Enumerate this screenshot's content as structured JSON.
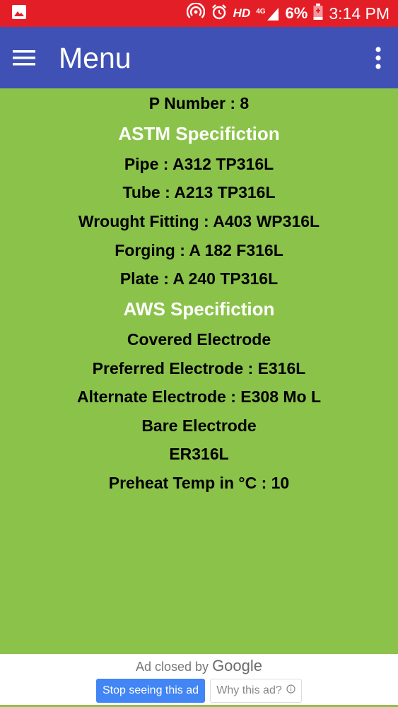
{
  "status_bar": {
    "network": "HD",
    "signal": "4G",
    "battery": "6%",
    "time": "3:14 PM",
    "icons": [
      "image-icon",
      "hotspot-icon",
      "alarm-icon",
      "signal-icon",
      "battery-charging-icon"
    ]
  },
  "app_bar": {
    "title": "Menu",
    "menu_icon": "hamburger-menu-icon",
    "overflow_icon": "more-vert-icon"
  },
  "content": {
    "p_number": "P Number : 8",
    "astm_heading": "ASTM Specifiction",
    "pipe": "Pipe : A312 TP316L",
    "tube": "Tube : A213 TP316L",
    "wrought_fitting": "Wrought Fitting : A403 WP316L",
    "forging": "Forging : A 182 F316L",
    "plate": "Plate : A 240 TP316L",
    "aws_heading": "AWS Specifiction",
    "covered_electrode": "Covered Electrode",
    "preferred_electrode": "Preferred Electrode : E316L",
    "alternate_electrode": "Alternate Electrode : E308 Mo L",
    "bare_electrode": "Bare Electrode",
    "er": "ER316L",
    "preheat": "Preheat Temp in °C : 10"
  },
  "ad": {
    "closed_by": "Ad closed by",
    "google": "Google",
    "stop_label": "Stop seeing this ad",
    "why_label": "Why this ad?"
  },
  "colors": {
    "status_bar": "#E41E26",
    "app_bar": "#3F51B5",
    "content_bg": "#8BC34A",
    "heading": "#FFFFFF",
    "ad_button": "#4285F4"
  }
}
